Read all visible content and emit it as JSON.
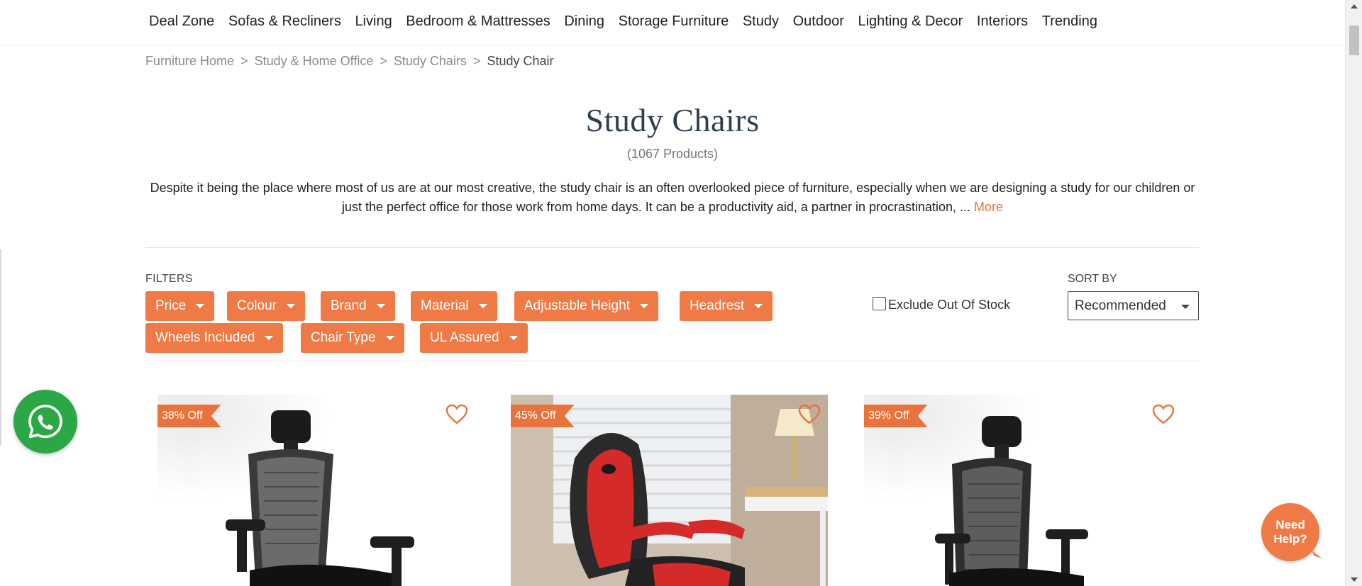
{
  "nav": {
    "items": [
      "Deal Zone",
      "Sofas & Recliners",
      "Living",
      "Bedroom & Mattresses",
      "Dining",
      "Storage Furniture",
      "Study",
      "Outdoor",
      "Lighting & Decor",
      "Interiors",
      "Trending"
    ]
  },
  "breadcrumb": {
    "items": [
      "Furniture Home",
      "Study & Home Office",
      "Study Chairs"
    ],
    "separator": ">",
    "current": "Study Chair"
  },
  "page": {
    "title": "Study Chairs",
    "count": "(1067 Products)",
    "description": "Despite it being the place where most of us are at our most creative, the study chair is an often overlooked piece of furniture, especially when we are designing a study for our children or just the perfect office for those work from home days. It can be a productivity aid, a partner in procrastination, ... ",
    "more_label": "More"
  },
  "filters": {
    "label": "FILTERS",
    "chips": [
      "Price",
      "Colour",
      "Brand",
      "Material",
      "Adjustable Height",
      "Headrest",
      "Wheels Included",
      "Chair Type",
      "UL Assured"
    ],
    "exclude_out_of_stock": {
      "label": "Exclude Out Of Stock",
      "checked": false
    }
  },
  "sort": {
    "label": "SORT BY",
    "selected": "Recommended"
  },
  "products": [
    {
      "discount": "38% Off",
      "wishlisted": false
    },
    {
      "discount": "45% Off",
      "wishlisted": false
    },
    {
      "discount": "39% Off",
      "wishlisted": false
    }
  ],
  "help": {
    "line1": "Need",
    "line2": "Help?"
  },
  "colors": {
    "accent": "#f07a45",
    "title": "#2d3e50",
    "whatsapp": "#2aa845"
  },
  "icons": [
    "whatsapp-icon",
    "heart-icon",
    "chevron-down-icon"
  ]
}
